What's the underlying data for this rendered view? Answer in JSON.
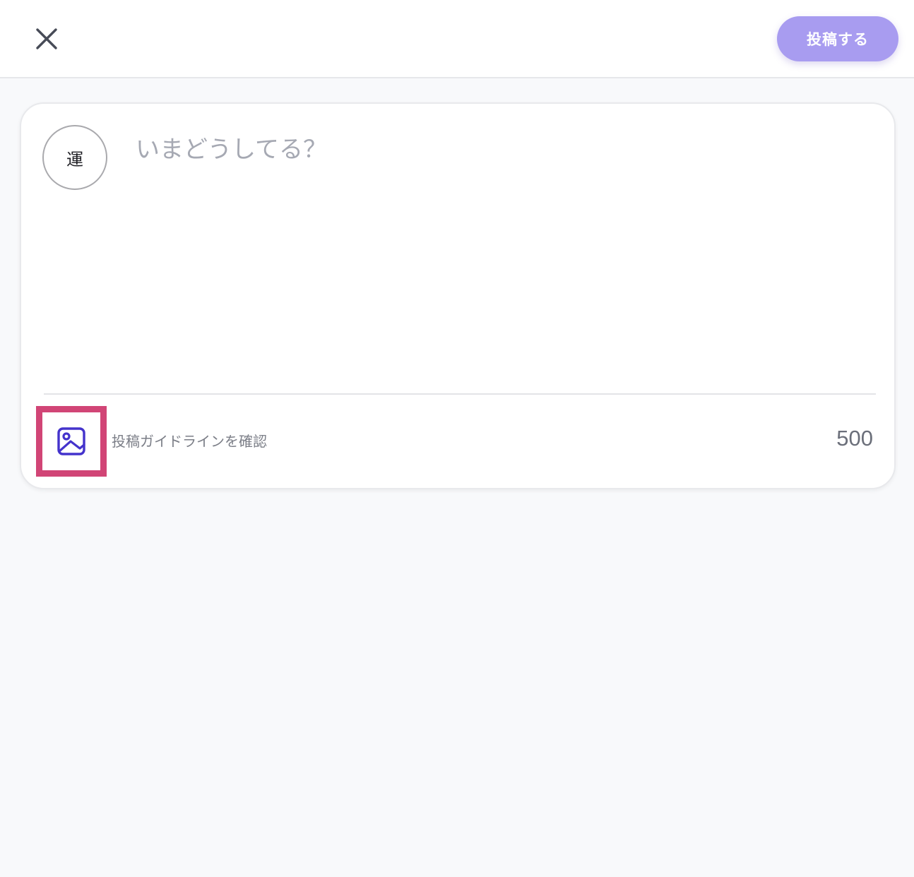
{
  "header": {
    "close_icon": "close-icon",
    "post_button_label": "投稿する",
    "post_button_color": "#a89cf0"
  },
  "composer": {
    "avatar_text": "運",
    "placeholder": "いまどうしてる？",
    "value": "",
    "image_icon": "image-icon",
    "image_icon_color": "#4433cc",
    "highlight_color": "#d14576",
    "guideline_link": "投稿ガイドラインを確認",
    "char_count": "500"
  }
}
